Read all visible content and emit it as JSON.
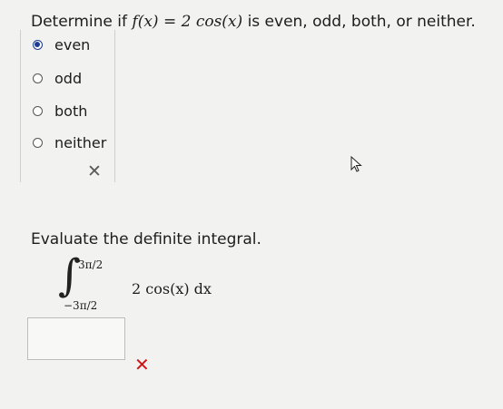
{
  "question1": {
    "prefix": "Determine if",
    "function": "f(x) = 2 cos(x)",
    "suffix": "is even, odd, both, or neither.",
    "options": [
      {
        "label": "even",
        "selected": true
      },
      {
        "label": "odd",
        "selected": false
      },
      {
        "label": "both",
        "selected": false
      },
      {
        "label": "neither",
        "selected": false
      }
    ],
    "result_icon": "gray-x-icon"
  },
  "question2": {
    "prompt": "Evaluate the definite integral.",
    "integral": {
      "upper_limit": "3π/2",
      "lower_limit": "−3π/2",
      "integrand": "2 cos(x) dx"
    },
    "answer_value": "",
    "result_icon": "red-x-icon"
  },
  "colors": {
    "selected_radio": "#1d3b8f",
    "incorrect_mark": "#d01414"
  }
}
